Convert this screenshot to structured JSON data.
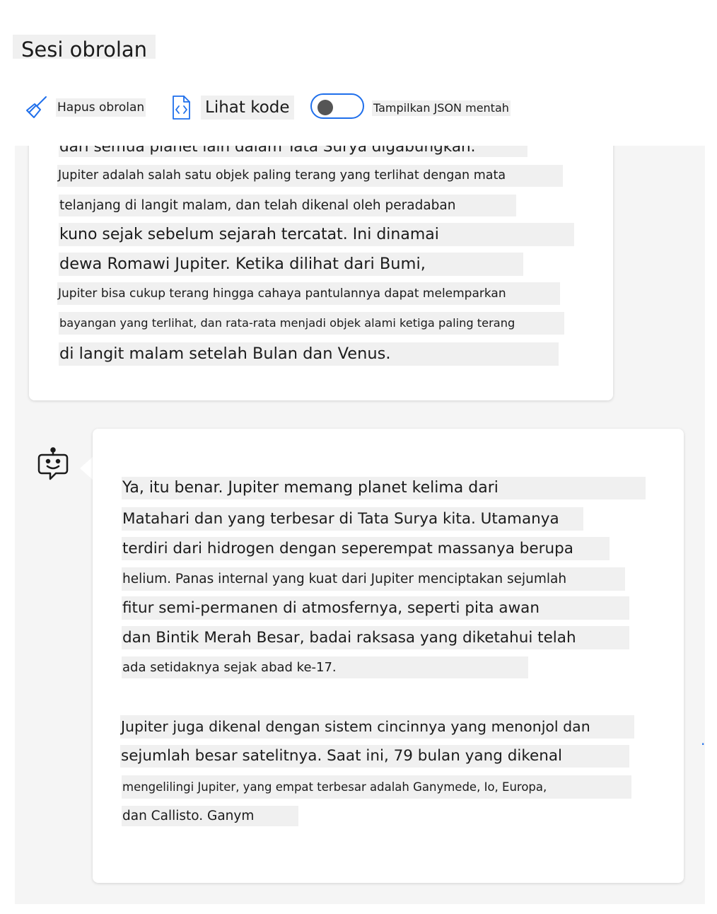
{
  "header": {
    "title": "Sesi obrolan"
  },
  "toolbar": {
    "clear_label": "Hapus obrolan",
    "code_label": "Lihat kode",
    "raw_json_label": "Tampilkan JSON mentah",
    "raw_json_on": false
  },
  "messages": {
    "user_lines": [
      "dari semua planet lain dalam Tata Surya digabungkan.",
      "Jupiter adalah salah satu objek paling terang yang terlihat dengan mata",
      "telanjang di langit malam, dan telah dikenal oleh peradaban",
      "kuno sejak sebelum sejarah tercatat. Ini dinamai",
      "dewa Romawi Jupiter. Ketika dilihat dari Bumi,",
      "Jupiter bisa cukup terang hingga cahaya pantulannya dapat melemparkan",
      "bayangan yang terlihat, dan rata-rata menjadi objek alami ketiga paling terang",
      "di langit malam setelah Bulan dan Venus."
    ],
    "assistant_lines": [
      "Ya, itu benar. Jupiter memang planet kelima dari",
      "Matahari dan yang terbesar di Tata Surya kita. Utamanya",
      "terdiri dari hidrogen dengan seperempat massanya berupa",
      "helium. Panas internal yang kuat dari Jupiter menciptakan sejumlah",
      "fitur semi-permanen di atmosfernya, seperti pita awan",
      "dan Bintik Merah Besar, badai raksasa yang diketahui telah",
      "ada setidaknya sejak abad ke-17.",
      "Jupiter juga dikenal dengan sistem cincinnya yang menonjol dan",
      "sejumlah besar satelitnya. Saat ini, 79 bulan yang dikenal",
      "mengelilingi Jupiter, yang empat terbesar adalah Ganymede, Io, Europa,",
      "dan Callisto. Ganym"
    ],
    "more_label": "..."
  }
}
